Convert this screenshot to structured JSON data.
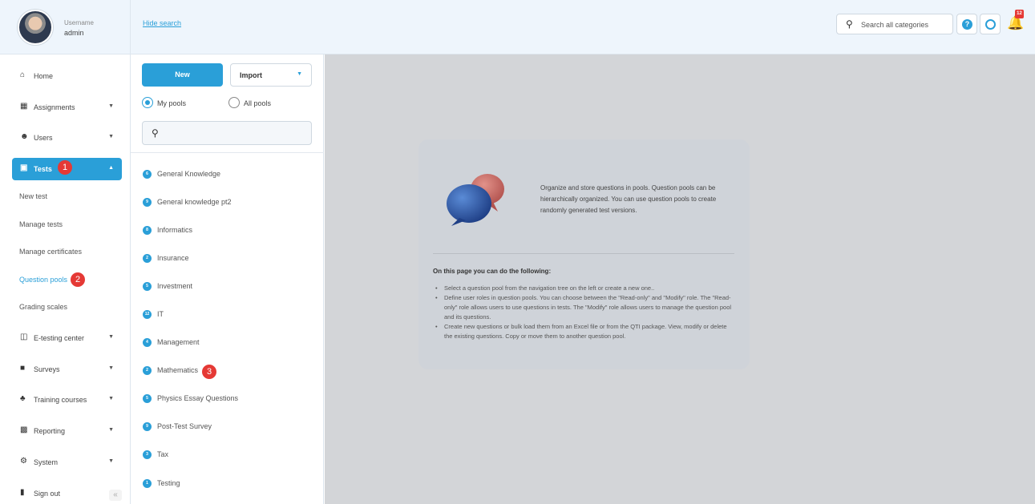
{
  "header": {
    "username_label": "Username",
    "username": "admin",
    "hide_search": "Hide search",
    "search_placeholder": "Search all categories",
    "notification_count": "12"
  },
  "sidebar": {
    "items": [
      {
        "label": "Home"
      },
      {
        "label": "Assignments"
      },
      {
        "label": "Users"
      },
      {
        "label": "Tests"
      },
      {
        "label": "E-testing center"
      },
      {
        "label": "Surveys"
      },
      {
        "label": "Training courses"
      },
      {
        "label": "Reporting"
      },
      {
        "label": "System"
      },
      {
        "label": "Sign out"
      }
    ],
    "sub_items": [
      {
        "label": "New test"
      },
      {
        "label": "Manage tests"
      },
      {
        "label": "Manage certificates"
      },
      {
        "label": "Question pools"
      },
      {
        "label": "Grading scales"
      }
    ],
    "collapse": "«"
  },
  "annotations": [
    "1",
    "2",
    "3"
  ],
  "toolbar": {
    "new_label": "New",
    "import_label": "Import",
    "my_pools_label": "My pools",
    "all_pools_label": "All pools"
  },
  "pools": [
    {
      "count": "6",
      "name": "General Knowledge"
    },
    {
      "count": "9",
      "name": "General knowledge pt2"
    },
    {
      "count": "8",
      "name": "Informatics"
    },
    {
      "count": "2",
      "name": "Insurance"
    },
    {
      "count": "5",
      "name": "Investment"
    },
    {
      "count": "12",
      "name": "IT"
    },
    {
      "count": "4",
      "name": "Management"
    },
    {
      "count": "2",
      "name": "Mathematics"
    },
    {
      "count": "5",
      "name": "Physics Essay Questions"
    },
    {
      "count": "9",
      "name": "Post-Test Survey"
    },
    {
      "count": "3",
      "name": "Tax"
    },
    {
      "count": "1",
      "name": "Testing"
    }
  ],
  "info": {
    "description": "Organize and store questions in pools. Question pools can be hierarchically organized. You can use question pools to create randomly generated test versions.",
    "heading": "On this page you can do the following:",
    "bullets": [
      "Select a question pool from the navigation tree on the left or create a new one..",
      "Define user roles in question pools. You can choose between the \"Read-only\" and \"Modify\" role. The \"Read-only\" role allows users to use questions in tests. The \"Modify\" role allows users to manage the question pool and its questions.",
      "Create new questions or bulk load them from an Excel file or from the QTI package. View, modify or delete the existing questions. Copy or move them to another question pool."
    ]
  },
  "colors": {
    "accent": "#2a9fd8",
    "annotation_red": "#e53935",
    "content_bg": "#d3d5d8"
  }
}
